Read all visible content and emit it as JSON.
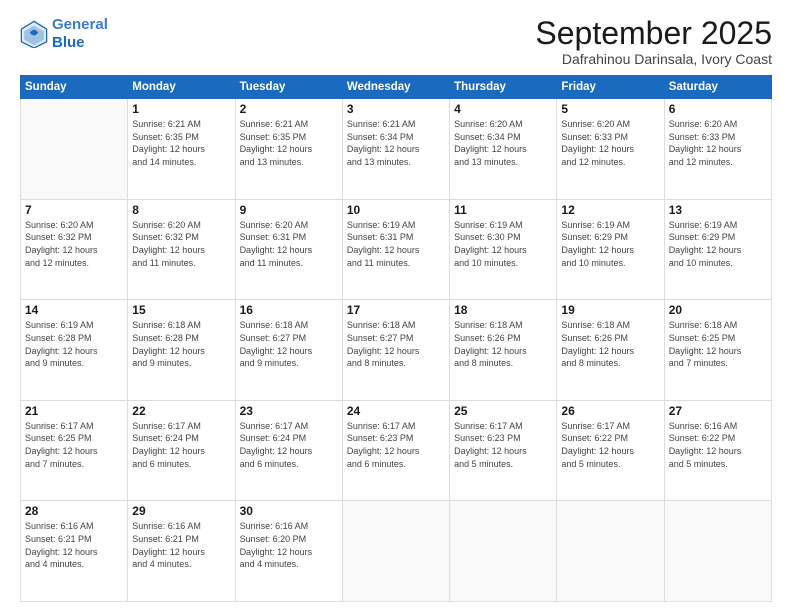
{
  "logo": {
    "line1": "General",
    "line2": "Blue"
  },
  "header": {
    "month": "September 2025",
    "location": "Dafrahinou Darinsala, Ivory Coast"
  },
  "weekdays": [
    "Sunday",
    "Monday",
    "Tuesday",
    "Wednesday",
    "Thursday",
    "Friday",
    "Saturday"
  ],
  "weeks": [
    [
      {
        "day": "",
        "info": ""
      },
      {
        "day": "1",
        "info": "Sunrise: 6:21 AM\nSunset: 6:35 PM\nDaylight: 12 hours\nand 14 minutes."
      },
      {
        "day": "2",
        "info": "Sunrise: 6:21 AM\nSunset: 6:35 PM\nDaylight: 12 hours\nand 13 minutes."
      },
      {
        "day": "3",
        "info": "Sunrise: 6:21 AM\nSunset: 6:34 PM\nDaylight: 12 hours\nand 13 minutes."
      },
      {
        "day": "4",
        "info": "Sunrise: 6:20 AM\nSunset: 6:34 PM\nDaylight: 12 hours\nand 13 minutes."
      },
      {
        "day": "5",
        "info": "Sunrise: 6:20 AM\nSunset: 6:33 PM\nDaylight: 12 hours\nand 12 minutes."
      },
      {
        "day": "6",
        "info": "Sunrise: 6:20 AM\nSunset: 6:33 PM\nDaylight: 12 hours\nand 12 minutes."
      }
    ],
    [
      {
        "day": "7",
        "info": "Sunrise: 6:20 AM\nSunset: 6:32 PM\nDaylight: 12 hours\nand 12 minutes."
      },
      {
        "day": "8",
        "info": "Sunrise: 6:20 AM\nSunset: 6:32 PM\nDaylight: 12 hours\nand 11 minutes."
      },
      {
        "day": "9",
        "info": "Sunrise: 6:20 AM\nSunset: 6:31 PM\nDaylight: 12 hours\nand 11 minutes."
      },
      {
        "day": "10",
        "info": "Sunrise: 6:19 AM\nSunset: 6:31 PM\nDaylight: 12 hours\nand 11 minutes."
      },
      {
        "day": "11",
        "info": "Sunrise: 6:19 AM\nSunset: 6:30 PM\nDaylight: 12 hours\nand 10 minutes."
      },
      {
        "day": "12",
        "info": "Sunrise: 6:19 AM\nSunset: 6:29 PM\nDaylight: 12 hours\nand 10 minutes."
      },
      {
        "day": "13",
        "info": "Sunrise: 6:19 AM\nSunset: 6:29 PM\nDaylight: 12 hours\nand 10 minutes."
      }
    ],
    [
      {
        "day": "14",
        "info": "Sunrise: 6:19 AM\nSunset: 6:28 PM\nDaylight: 12 hours\nand 9 minutes."
      },
      {
        "day": "15",
        "info": "Sunrise: 6:18 AM\nSunset: 6:28 PM\nDaylight: 12 hours\nand 9 minutes."
      },
      {
        "day": "16",
        "info": "Sunrise: 6:18 AM\nSunset: 6:27 PM\nDaylight: 12 hours\nand 9 minutes."
      },
      {
        "day": "17",
        "info": "Sunrise: 6:18 AM\nSunset: 6:27 PM\nDaylight: 12 hours\nand 8 minutes."
      },
      {
        "day": "18",
        "info": "Sunrise: 6:18 AM\nSunset: 6:26 PM\nDaylight: 12 hours\nand 8 minutes."
      },
      {
        "day": "19",
        "info": "Sunrise: 6:18 AM\nSunset: 6:26 PM\nDaylight: 12 hours\nand 8 minutes."
      },
      {
        "day": "20",
        "info": "Sunrise: 6:18 AM\nSunset: 6:25 PM\nDaylight: 12 hours\nand 7 minutes."
      }
    ],
    [
      {
        "day": "21",
        "info": "Sunrise: 6:17 AM\nSunset: 6:25 PM\nDaylight: 12 hours\nand 7 minutes."
      },
      {
        "day": "22",
        "info": "Sunrise: 6:17 AM\nSunset: 6:24 PM\nDaylight: 12 hours\nand 6 minutes."
      },
      {
        "day": "23",
        "info": "Sunrise: 6:17 AM\nSunset: 6:24 PM\nDaylight: 12 hours\nand 6 minutes."
      },
      {
        "day": "24",
        "info": "Sunrise: 6:17 AM\nSunset: 6:23 PM\nDaylight: 12 hours\nand 6 minutes."
      },
      {
        "day": "25",
        "info": "Sunrise: 6:17 AM\nSunset: 6:23 PM\nDaylight: 12 hours\nand 5 minutes."
      },
      {
        "day": "26",
        "info": "Sunrise: 6:17 AM\nSunset: 6:22 PM\nDaylight: 12 hours\nand 5 minutes."
      },
      {
        "day": "27",
        "info": "Sunrise: 6:16 AM\nSunset: 6:22 PM\nDaylight: 12 hours\nand 5 minutes."
      }
    ],
    [
      {
        "day": "28",
        "info": "Sunrise: 6:16 AM\nSunset: 6:21 PM\nDaylight: 12 hours\nand 4 minutes."
      },
      {
        "day": "29",
        "info": "Sunrise: 6:16 AM\nSunset: 6:21 PM\nDaylight: 12 hours\nand 4 minutes."
      },
      {
        "day": "30",
        "info": "Sunrise: 6:16 AM\nSunset: 6:20 PM\nDaylight: 12 hours\nand 4 minutes."
      },
      {
        "day": "",
        "info": ""
      },
      {
        "day": "",
        "info": ""
      },
      {
        "day": "",
        "info": ""
      },
      {
        "day": "",
        "info": ""
      }
    ]
  ]
}
